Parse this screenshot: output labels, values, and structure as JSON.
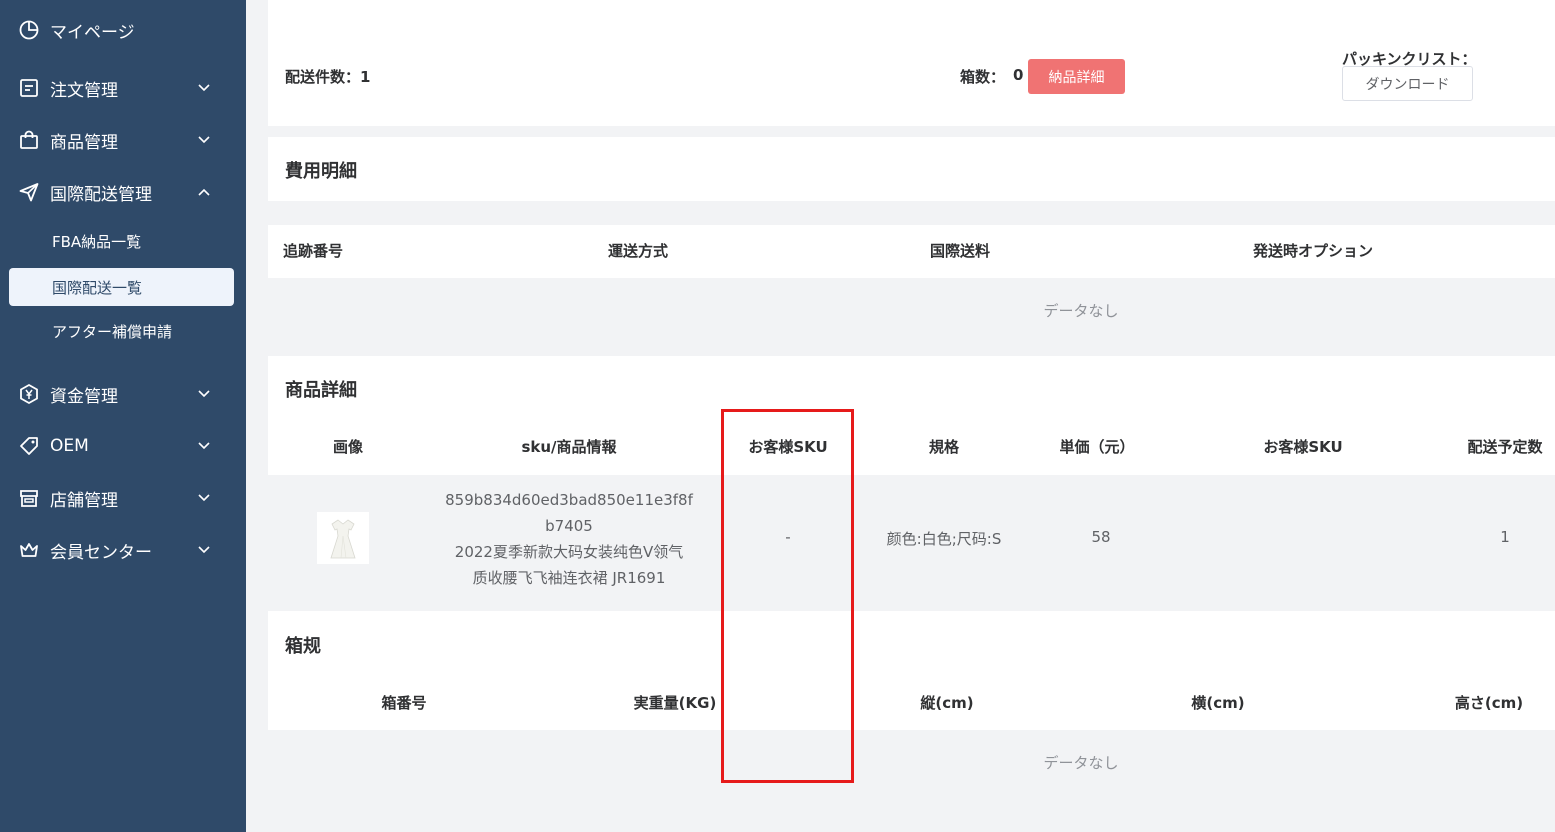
{
  "sidebar": {
    "items": [
      {
        "label": "マイページ",
        "icon": "dashboard-icon"
      },
      {
        "label": "注文管理",
        "icon": "order-icon"
      },
      {
        "label": "商品管理",
        "icon": "shopping-bag-icon"
      },
      {
        "label": "国際配送管理",
        "icon": "send-icon"
      },
      {
        "label": "資金管理",
        "icon": "yen-icon"
      },
      {
        "label": "OEM",
        "icon": "tag-icon"
      },
      {
        "label": "店舗管理",
        "icon": "store-icon"
      },
      {
        "label": "会員センター",
        "icon": "crown-icon"
      }
    ],
    "sub_items": [
      {
        "label": "FBA納品一覧"
      },
      {
        "label": "国際配送一覧"
      },
      {
        "label": "アフター補償申請"
      }
    ]
  },
  "shipment": {
    "count_label": "配送件数：1",
    "boxes_label": "箱数：",
    "boxes_value": "0",
    "delivery_detail_button": "納品詳細",
    "packing_list_label": "パッキンクリスト：",
    "download_button": "ダウンロード"
  },
  "costs": {
    "title": "費用明細",
    "columns": [
      "追跡番号",
      "運送方式",
      "国際送料",
      "発送時オプション"
    ],
    "empty_text": "データなし"
  },
  "products": {
    "title": "商品詳細",
    "columns": [
      "画像",
      "sku/商品情報",
      "お客様SKU",
      "規格",
      "単価（元）",
      "お客様SKU",
      "配送予定数"
    ],
    "rows": [
      {
        "sku_line1": "859b834d60ed3bad850e11e3f8f",
        "sku_line2": "b7405",
        "name_line1": "2022夏季新款大码女装纯色V领气",
        "name_line2": "质收腰飞飞袖连衣裙 JR1691",
        "customer_sku": "-",
        "spec": "颜色:白色;尺码:S",
        "unit_price": "58",
        "customer_sku2": "",
        "planned_qty": "1"
      }
    ]
  },
  "boxes": {
    "title": "箱规",
    "columns": [
      "箱番号",
      "実重量(KG)",
      "縦(cm)",
      "横(cm)",
      "高さ(cm)"
    ],
    "empty_text": "データなし"
  },
  "colors": {
    "sidebar_bg": "#2f4a69",
    "accent_red": "#f07373",
    "highlight_border": "#e61a1a"
  }
}
